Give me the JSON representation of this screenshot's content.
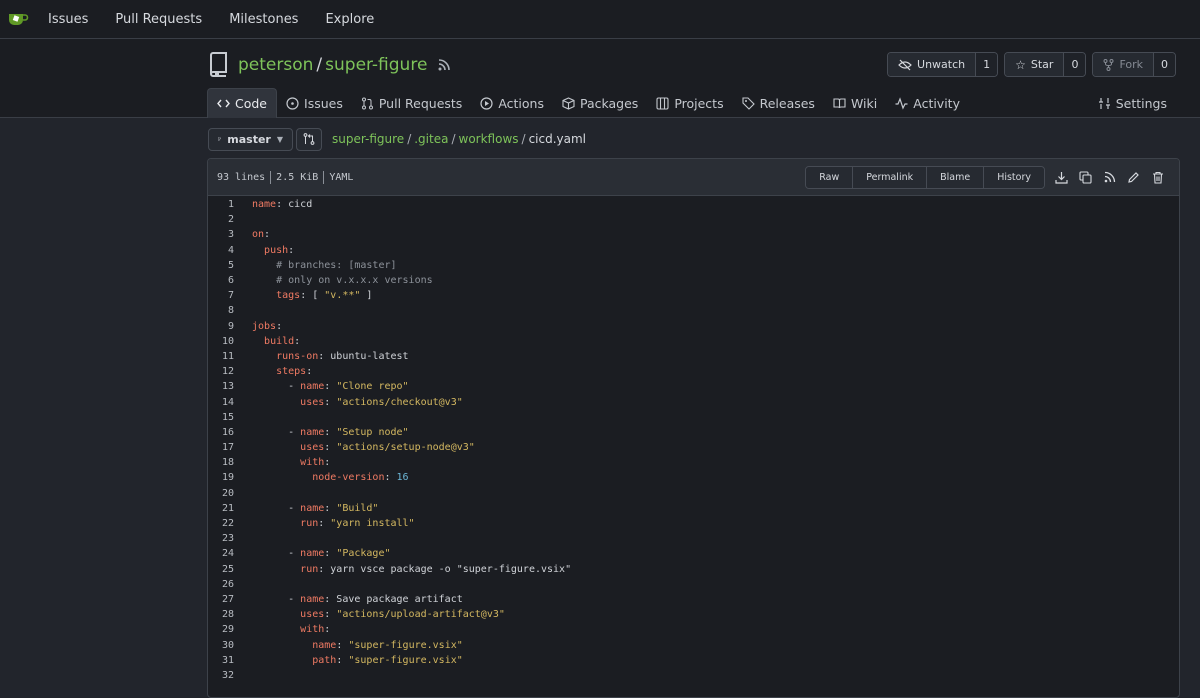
{
  "topnav": {
    "items": [
      "Issues",
      "Pull Requests",
      "Milestones",
      "Explore"
    ]
  },
  "repo": {
    "owner": "peterson",
    "name": "super-figure",
    "watch_label": "Unwatch",
    "watch_count": "1",
    "star_label": "Star",
    "star_count": "0",
    "fork_label": "Fork",
    "fork_count": "0"
  },
  "tabs": [
    {
      "label": "Code",
      "icon": "code-icon"
    },
    {
      "label": "Issues",
      "icon": "issue-icon"
    },
    {
      "label": "Pull Requests",
      "icon": "pull-request-icon"
    },
    {
      "label": "Actions",
      "icon": "play-icon"
    },
    {
      "label": "Packages",
      "icon": "package-icon"
    },
    {
      "label": "Projects",
      "icon": "project-icon"
    },
    {
      "label": "Releases",
      "icon": "tag-icon"
    },
    {
      "label": "Wiki",
      "icon": "book-icon"
    },
    {
      "label": "Activity",
      "icon": "pulse-icon"
    },
    {
      "label": "Settings",
      "icon": "tools-icon"
    }
  ],
  "branch": "master",
  "breadcrumb": {
    "parts": [
      "super-figure",
      ".gitea",
      "workflows"
    ],
    "current": "cicd.yaml"
  },
  "file": {
    "lines": "93 lines",
    "size": "2.5 KiB",
    "lang": "YAML",
    "buttons": [
      "Raw",
      "Permalink",
      "Blame",
      "History"
    ]
  },
  "code": [
    [
      [
        "k",
        "name"
      ],
      [
        "t",
        ": cicd"
      ]
    ],
    [],
    [
      [
        "k",
        "on"
      ],
      [
        "t",
        ":"
      ]
    ],
    [
      [
        "t",
        "  "
      ],
      [
        "k",
        "push"
      ],
      [
        "t",
        ":"
      ]
    ],
    [
      [
        "t",
        "    "
      ],
      [
        "c",
        "# branches: [master]"
      ]
    ],
    [
      [
        "t",
        "    "
      ],
      [
        "c",
        "# only on v.x.x.x versions"
      ]
    ],
    [
      [
        "t",
        "    "
      ],
      [
        "k",
        "tags"
      ],
      [
        "t",
        ": [ "
      ],
      [
        "s",
        "\"v.**\""
      ],
      [
        "t",
        " ]"
      ]
    ],
    [],
    [
      [
        "k",
        "jobs"
      ],
      [
        "t",
        ":"
      ]
    ],
    [
      [
        "t",
        "  "
      ],
      [
        "k",
        "build"
      ],
      [
        "t",
        ":"
      ]
    ],
    [
      [
        "t",
        "    "
      ],
      [
        "k",
        "runs-on"
      ],
      [
        "t",
        ": ubuntu-latest"
      ]
    ],
    [
      [
        "t",
        "    "
      ],
      [
        "k",
        "steps"
      ],
      [
        "t",
        ":"
      ]
    ],
    [
      [
        "t",
        "      - "
      ],
      [
        "k",
        "name"
      ],
      [
        "t",
        ": "
      ],
      [
        "s",
        "\"Clone repo\""
      ]
    ],
    [
      [
        "t",
        "        "
      ],
      [
        "k",
        "uses"
      ],
      [
        "t",
        ": "
      ],
      [
        "s",
        "\"actions/checkout@v3\""
      ]
    ],
    [],
    [
      [
        "t",
        "      - "
      ],
      [
        "k",
        "name"
      ],
      [
        "t",
        ": "
      ],
      [
        "s",
        "\"Setup node\""
      ]
    ],
    [
      [
        "t",
        "        "
      ],
      [
        "k",
        "uses"
      ],
      [
        "t",
        ": "
      ],
      [
        "s",
        "\"actions/setup-node@v3\""
      ]
    ],
    [
      [
        "t",
        "        "
      ],
      [
        "k",
        "with"
      ],
      [
        "t",
        ":"
      ]
    ],
    [
      [
        "t",
        "          "
      ],
      [
        "k",
        "node-version"
      ],
      [
        "t",
        ": "
      ],
      [
        "n",
        "16"
      ]
    ],
    [],
    [
      [
        "t",
        "      - "
      ],
      [
        "k",
        "name"
      ],
      [
        "t",
        ": "
      ],
      [
        "s",
        "\"Build\""
      ]
    ],
    [
      [
        "t",
        "        "
      ],
      [
        "k",
        "run"
      ],
      [
        "t",
        ": "
      ],
      [
        "s",
        "\"yarn install\""
      ]
    ],
    [],
    [
      [
        "t",
        "      - "
      ],
      [
        "k",
        "name"
      ],
      [
        "t",
        ": "
      ],
      [
        "s",
        "\"Package\""
      ]
    ],
    [
      [
        "t",
        "        "
      ],
      [
        "k",
        "run"
      ],
      [
        "t",
        ": yarn vsce package -o \"super-figure.vsix\""
      ]
    ],
    [],
    [
      [
        "t",
        "      - "
      ],
      [
        "k",
        "name"
      ],
      [
        "t",
        ": Save package artifact"
      ]
    ],
    [
      [
        "t",
        "        "
      ],
      [
        "k",
        "uses"
      ],
      [
        "t",
        ": "
      ],
      [
        "s",
        "\"actions/upload-artifact@v3\""
      ]
    ],
    [
      [
        "t",
        "        "
      ],
      [
        "k",
        "with"
      ],
      [
        "t",
        ":"
      ]
    ],
    [
      [
        "t",
        "          "
      ],
      [
        "k",
        "name"
      ],
      [
        "t",
        ": "
      ],
      [
        "s",
        "\"super-figure.vsix\""
      ]
    ],
    [
      [
        "t",
        "          "
      ],
      [
        "k",
        "path"
      ],
      [
        "t",
        ": "
      ],
      [
        "s",
        "\"super-figure.vsix\""
      ]
    ],
    []
  ]
}
